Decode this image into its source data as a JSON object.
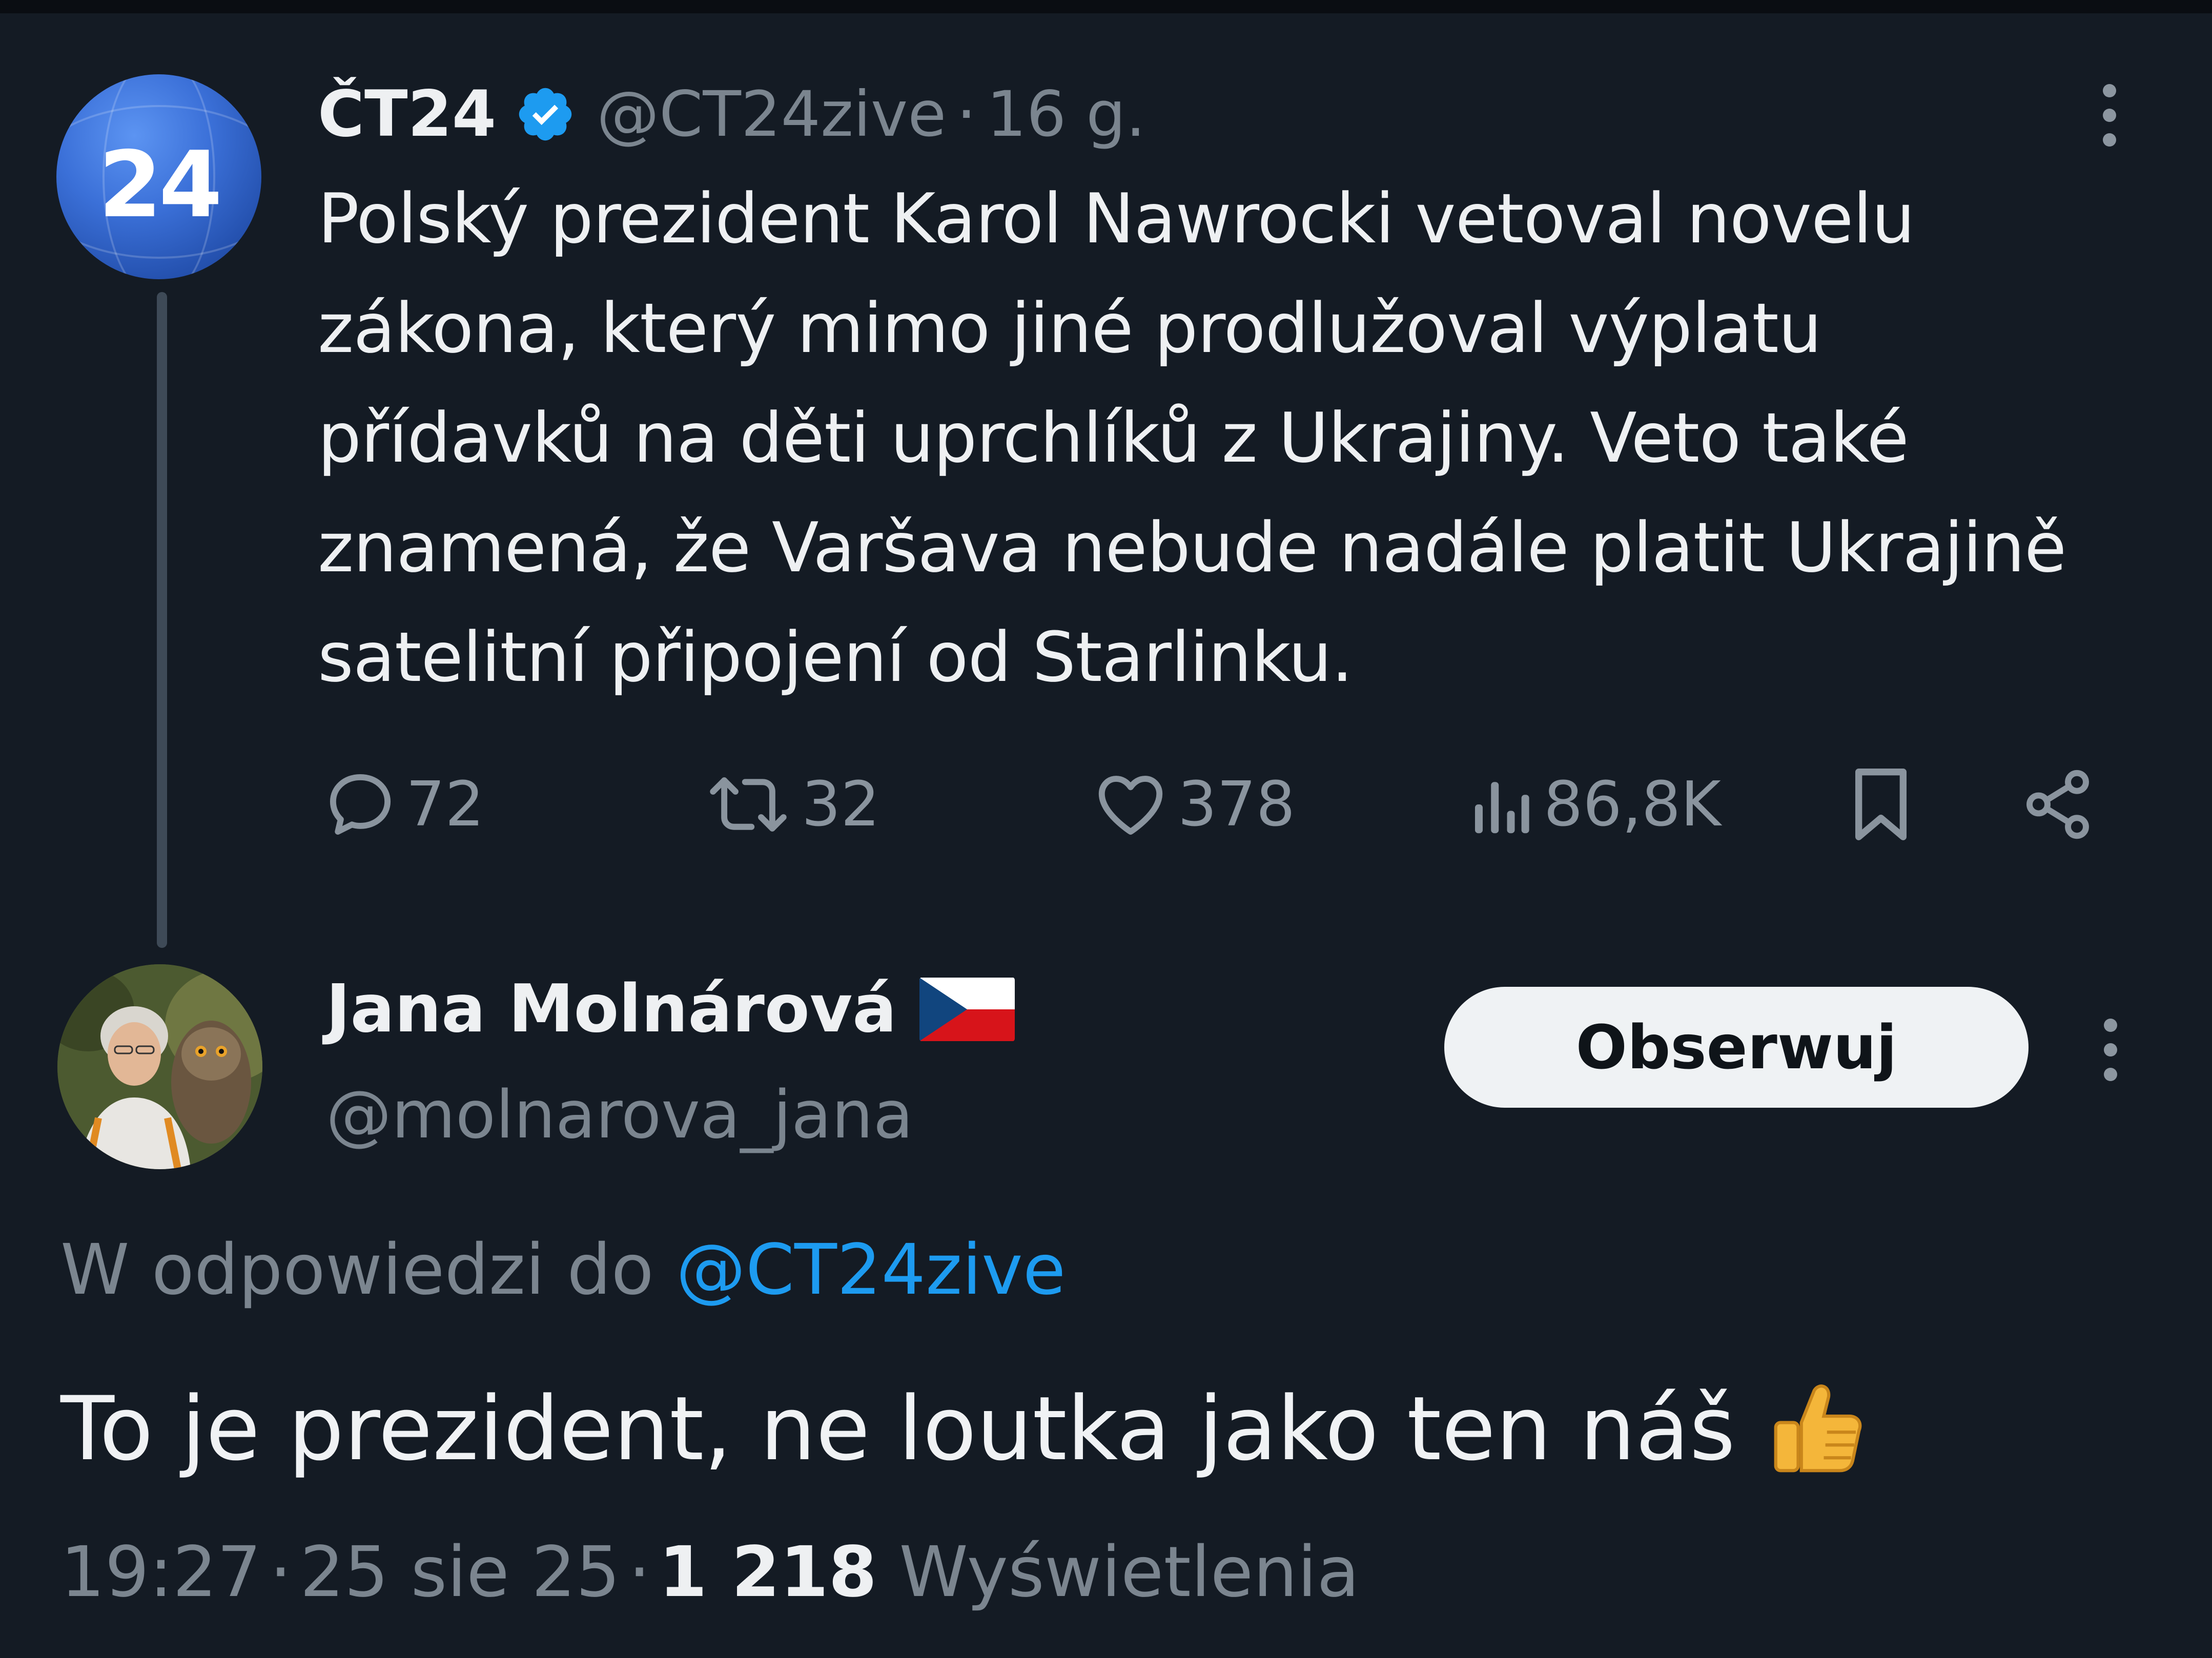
{
  "tweet": {
    "author_name": "ČT24",
    "avatar_text": "24",
    "handle": "@CT24zive",
    "separator": "·",
    "time_ago": "16 g.",
    "text": "Polský prezident Karol Nawrocki vetoval novelu zákona, který mimo jiné prodlužoval výplatu přídavků na děti uprchlíků z Ukrajiny. Veto také znamená, že Varšava nebude nadále platit Ukrajině satelitní připojení od Starlinku.",
    "stats": {
      "replies": "72",
      "reposts": "32",
      "likes": "378",
      "views": "86,8K"
    },
    "icons": [
      "verified-badge-icon",
      "reply-icon",
      "repost-icon",
      "like-icon",
      "views-icon",
      "bookmark-icon",
      "share-icon",
      "more-icon"
    ]
  },
  "reply": {
    "author_name": "Jana Molnárová",
    "handle": "@molnarova_jana",
    "follow_label": "Obserwuj",
    "reply_to_prefix": "W odpowiedzi do",
    "reply_to_handle": "@CT24zive",
    "text": "To je prezident, ne loutka jako ten náš",
    "time": "19:27",
    "separator": "·",
    "date": "25 sie 25",
    "views_count": "1 218",
    "views_label": "Wyświetlenia",
    "icons": [
      "czech-flag-icon",
      "thumbs-up-icon",
      "more-icon"
    ]
  },
  "colors": {
    "background": "#141b24",
    "text": "#eef0f2",
    "muted": "#7b858f",
    "link": "#1d9bf0",
    "verified": "#1d9bf0"
  }
}
